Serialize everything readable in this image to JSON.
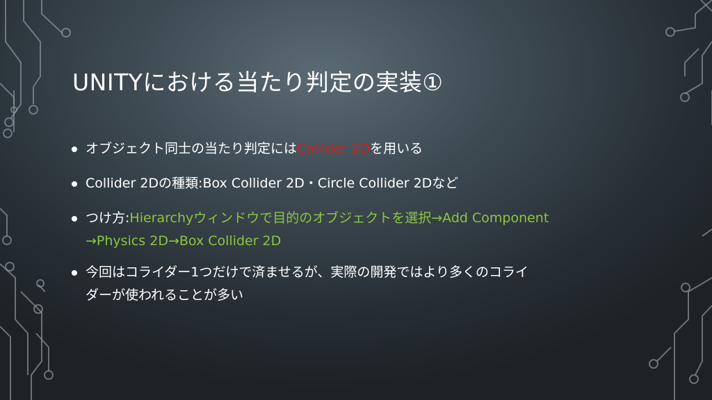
{
  "slide": {
    "title": "UNITYにおける当たり判定の実装①",
    "bullets": [
      {
        "prefix": "オブジェクト同士の当たり判定には",
        "highlight": "Collider 2D",
        "suffix": "を用いる"
      },
      {
        "text": "Collider 2Dの種類:Box Collider 2D・Circle Collider 2Dなど"
      },
      {
        "prefix": "つけ方:",
        "highlight_line1": "Hierarchyウィンドウで目的のオブジェクトを選択→Add Component",
        "highlight_line2": "→Physics 2D→Box Collider 2D"
      },
      {
        "line1": "今回はコライダー1つだけで済ませるが、実際の開発ではより多くのコライ",
        "line2": "ダーが使われることが多い"
      }
    ]
  },
  "colors": {
    "highlight_red": "#d21f1f",
    "highlight_green": "#8cc63f",
    "text": "#ffffff"
  }
}
